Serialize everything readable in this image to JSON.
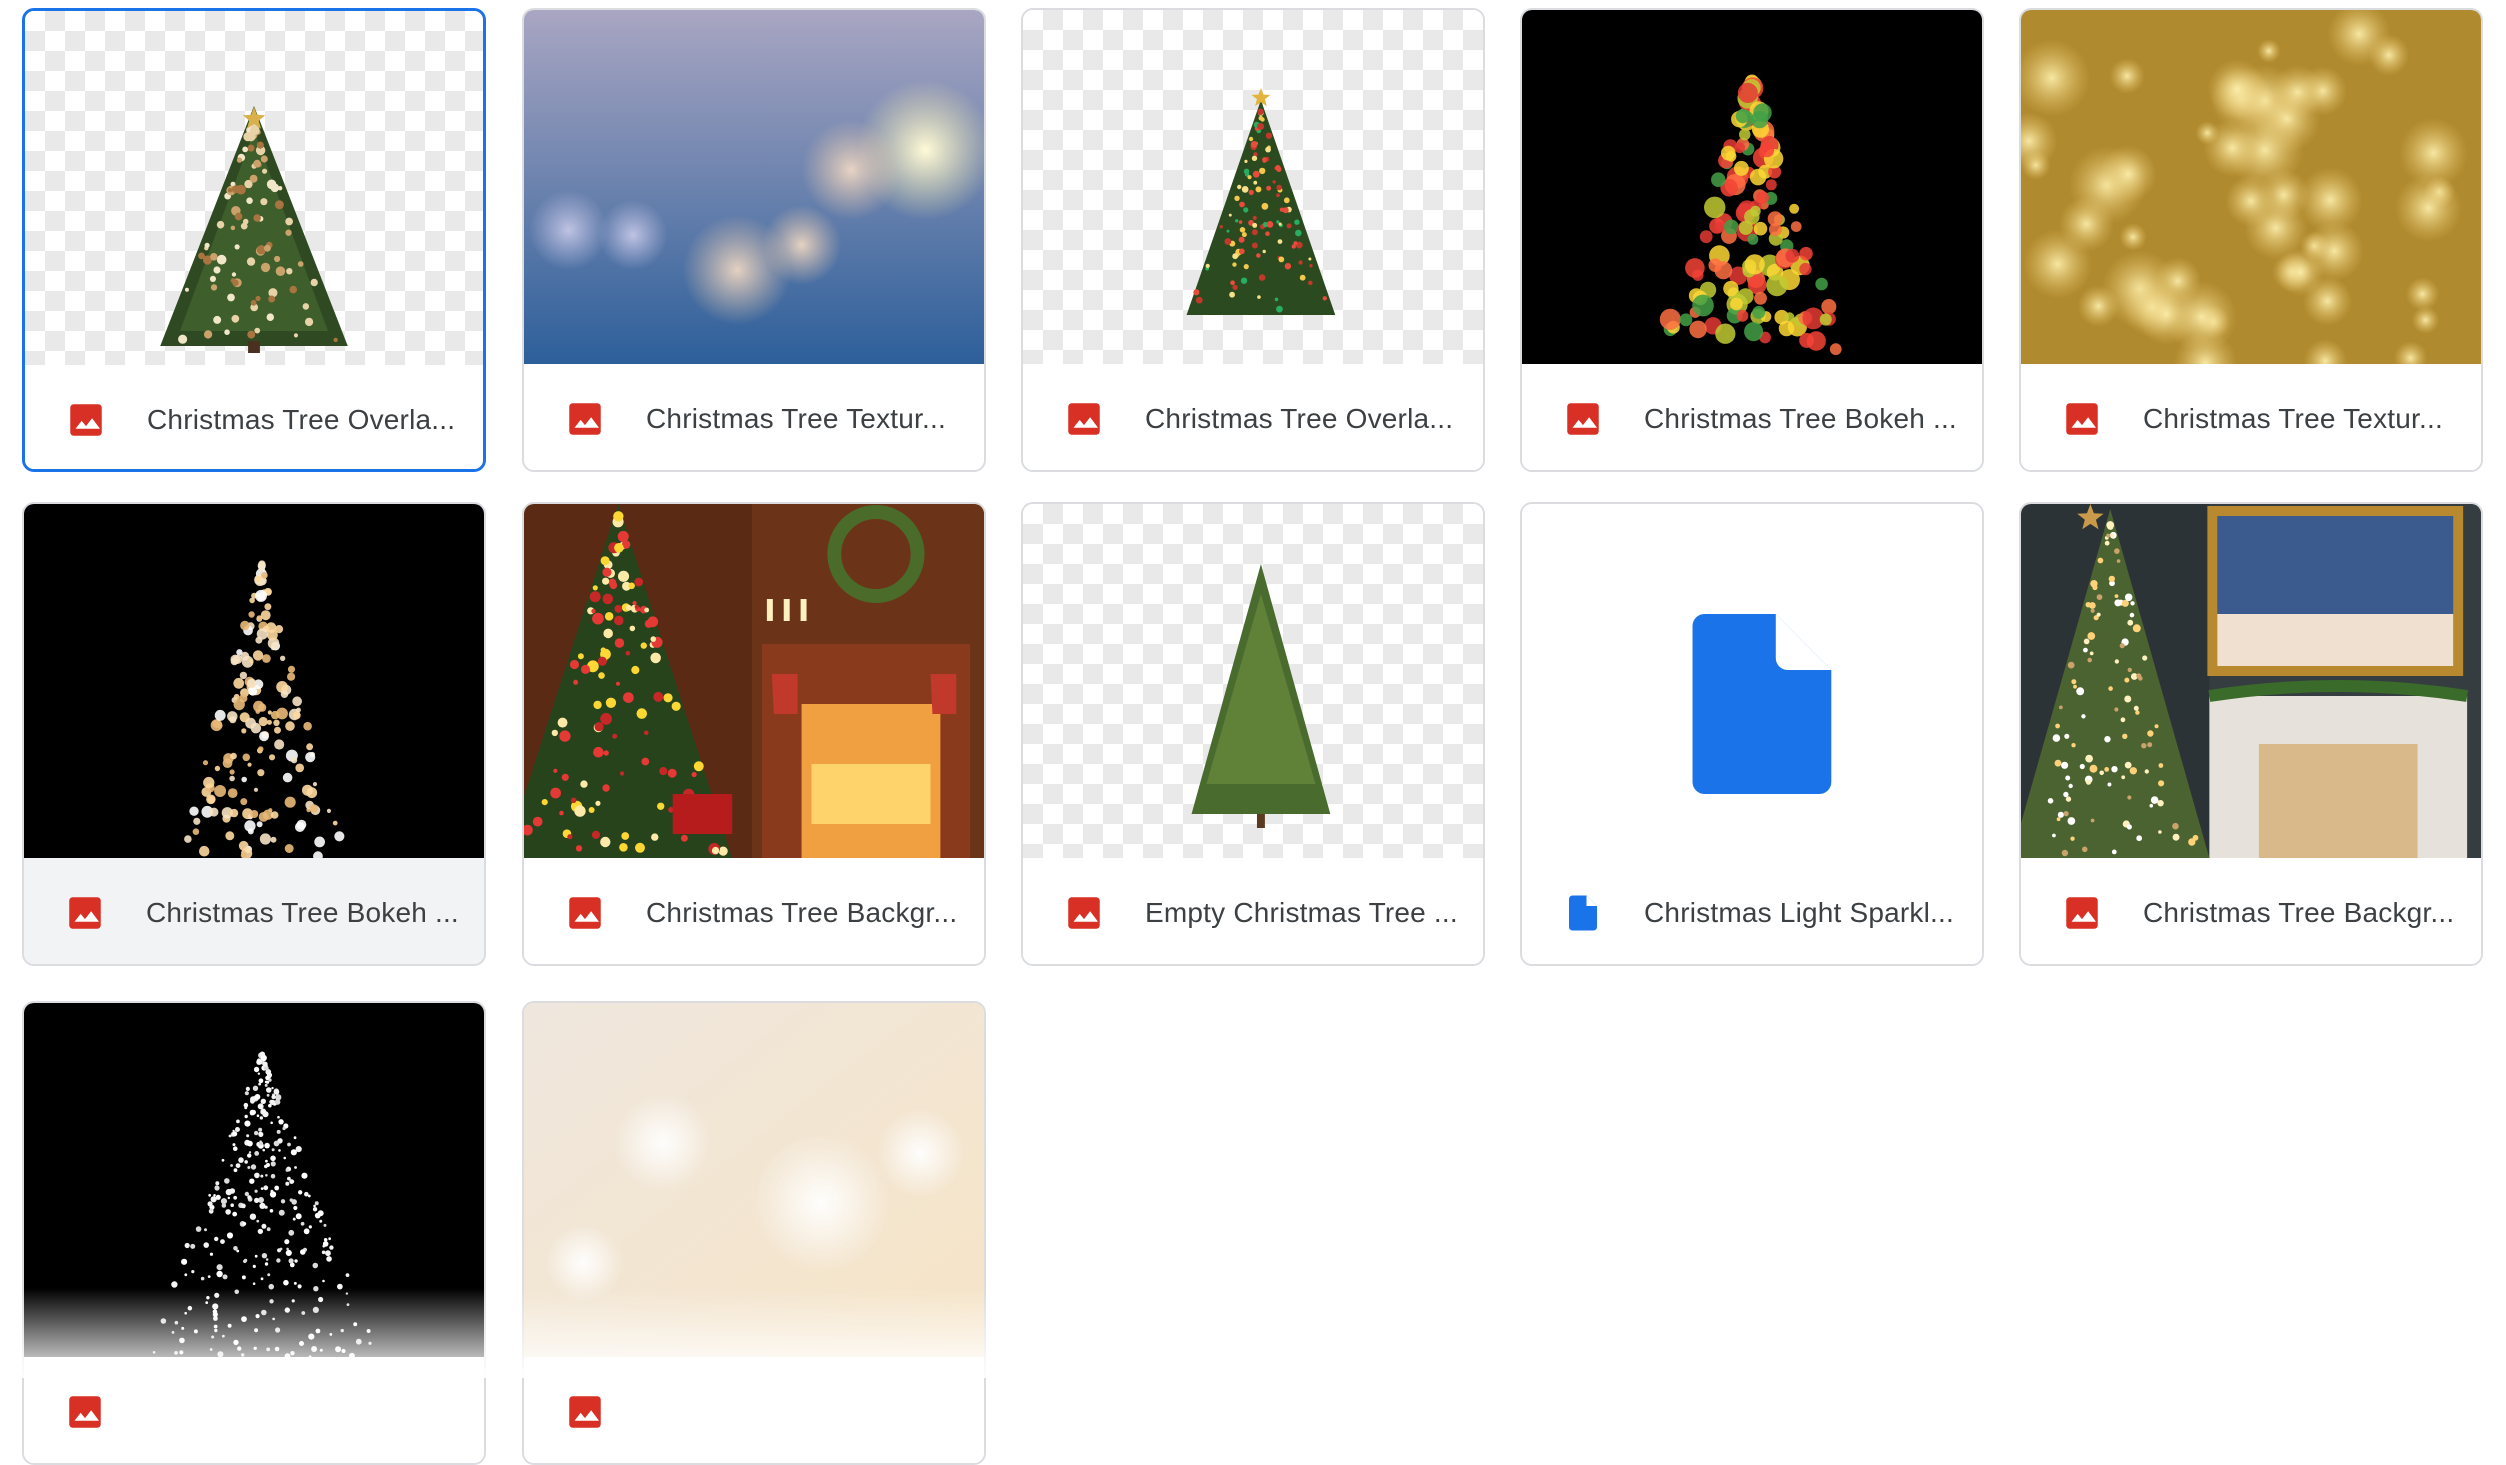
{
  "files": [
    {
      "name": "Christmas Tree Overla...",
      "type": "image",
      "icon": "image-file-icon",
      "thumb": "tree-ornaments-transparent",
      "state": "selected"
    },
    {
      "name": "Christmas Tree Textur...",
      "type": "image",
      "icon": "image-file-icon",
      "thumb": "blue-bokeh-texture"
    },
    {
      "name": "Christmas Tree Overla...",
      "type": "image",
      "icon": "image-file-icon",
      "thumb": "tree-lights-transparent"
    },
    {
      "name": "Christmas Tree Bokeh ...",
      "type": "image",
      "icon": "image-file-icon",
      "thumb": "colored-bokeh-tree"
    },
    {
      "name": "Christmas Tree Textur...",
      "type": "image",
      "icon": "image-file-icon",
      "thumb": "gold-bokeh-texture"
    },
    {
      "name": "Christmas Tree Bokeh ...",
      "type": "image",
      "icon": "image-file-icon",
      "thumb": "warm-bokeh-tree",
      "state": "hovered"
    },
    {
      "name": "Christmas Tree Backgr...",
      "type": "image",
      "icon": "image-file-icon",
      "thumb": "fireplace-room"
    },
    {
      "name": "Empty Christmas Tree ...",
      "type": "image",
      "icon": "image-file-icon",
      "thumb": "plain-fir-transparent"
    },
    {
      "name": "Christmas Light Sparkl...",
      "type": "document",
      "icon": "document-file-icon",
      "thumb": "generic-doc"
    },
    {
      "name": "Christmas Tree Backgr...",
      "type": "image",
      "icon": "image-file-icon",
      "thumb": "tree-fireplace-painting"
    },
    {
      "name": "",
      "type": "image",
      "icon": "image-file-icon",
      "thumb": "white-sparkle-tree"
    },
    {
      "name": "",
      "type": "image",
      "icon": "image-file-icon",
      "thumb": "cream-bokeh"
    }
  ],
  "colors": {
    "selected_border": "#1a73e8",
    "card_border": "#dadce0",
    "label_text": "#3c4043",
    "image_icon": "#d93025",
    "doc_icon": "#1a73e8",
    "hover_bg": "#f1f3f4"
  }
}
